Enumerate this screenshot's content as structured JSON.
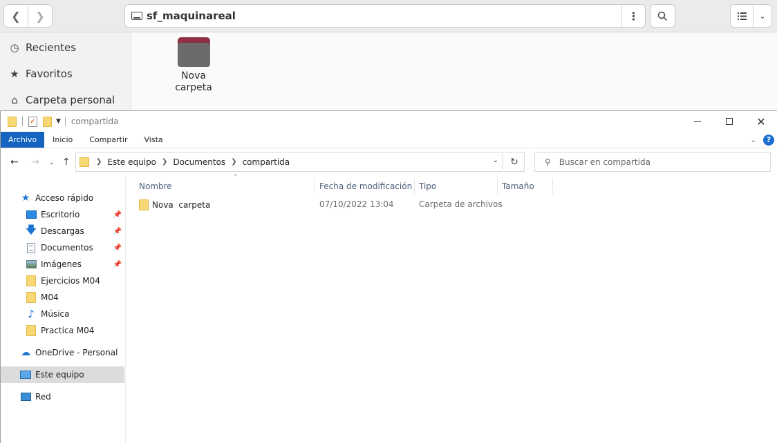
{
  "nautilus": {
    "path_label": "sf_maquinareal",
    "sidebar": [
      {
        "label": "Recientes",
        "icon": "clock-icon"
      },
      {
        "label": "Favoritos",
        "icon": "star-icon"
      },
      {
        "label": "Carpeta personal",
        "icon": "home-icon"
      }
    ],
    "folder": {
      "line1": "Nova",
      "line2": "carpeta"
    }
  },
  "explorer": {
    "title": "compartida",
    "ribbon_tabs": [
      "Archivo",
      "Inicio",
      "Compartir",
      "Vista"
    ],
    "address": {
      "crumbs": [
        "Este equipo",
        "Documentos",
        "compartida"
      ]
    },
    "search_placeholder": "Buscar en compartida",
    "nav": {
      "quick_access": "Acceso rápido",
      "pinned": [
        "Escritorio",
        "Descargas",
        "Documentos",
        "Imágenes"
      ],
      "recent": [
        "Ejercicios M04",
        "M04",
        "Música",
        "Practica M04"
      ],
      "onedrive": "OneDrive - Personal",
      "this_pc": "Este equipo",
      "network": "Red"
    },
    "columns": [
      "Nombre",
      "Fecha de modificación",
      "Tipo",
      "Tamaño"
    ],
    "files": [
      {
        "name": "Nova  carpeta",
        "date": "07/10/2022 13:04",
        "type": "Carpeta de archivos",
        "size": ""
      }
    ]
  },
  "colors": {
    "accent": "#1565c0",
    "folder_yellow": "#f8d775",
    "ubuntu_folder": "#8e2f45"
  }
}
